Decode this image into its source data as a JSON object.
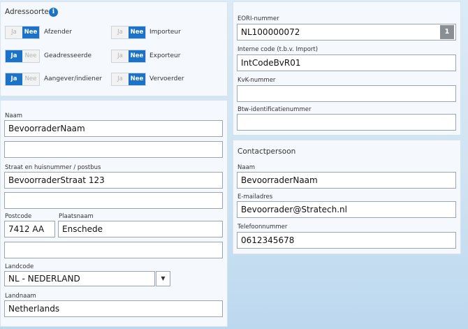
{
  "address_types": {
    "title": "Adressoorten",
    "info_icon": "info-circle-icon",
    "yes": "Ja",
    "no": "Nee",
    "items": [
      {
        "label": "Afzender",
        "value": "Nee"
      },
      {
        "label": "Importeur",
        "value": "Nee"
      },
      {
        "label": "Geadresseerde",
        "value": "Ja"
      },
      {
        "label": "Exporteur",
        "value": "Nee"
      },
      {
        "label": "Aangever/indiener",
        "value": "Ja"
      },
      {
        "label": "Vervoerder",
        "value": "Nee"
      }
    ]
  },
  "ids": {
    "eori_label": "EORI-nummer",
    "eori_value": "NL100000072",
    "eori_badge": "1",
    "internal_label": "Interne code (t.b.v. Import)",
    "internal_value": "IntCodeBvR01",
    "kvk_label": "KvK-nummer",
    "kvk_value": "",
    "vat_label": "Btw-identificatienummer",
    "vat_value": ""
  },
  "address": {
    "name_label": "Naam",
    "name_value": "BevoorraderNaam",
    "name2_value": "",
    "street_label": "Straat en huisnummer / postbus",
    "street_value": "BevoorraderStraat 123",
    "street2_value": "",
    "postcode_label": "Postcode",
    "postcode_value": "7412 AA",
    "city_label": "Plaatsnaam",
    "city_value": "Enschede",
    "extra_value": "",
    "country_code_label": "Landcode",
    "country_code_value": "NL - NEDERLAND",
    "country_name_label": "Landnaam",
    "country_name_value": "Netherlands"
  },
  "contact": {
    "title": "Contactpersoon",
    "name_label": "Naam",
    "name_value": "BevoorraderNaam",
    "email_label": "E-mailadres",
    "email_value": "Bevoorrader@Stratech.nl",
    "phone_label": "Telefoonnummer",
    "phone_value": "0612345678"
  },
  "colors": {
    "accent": "#1a73c9",
    "panel": "#f5f9fd",
    "background": "#cfe3f2"
  }
}
